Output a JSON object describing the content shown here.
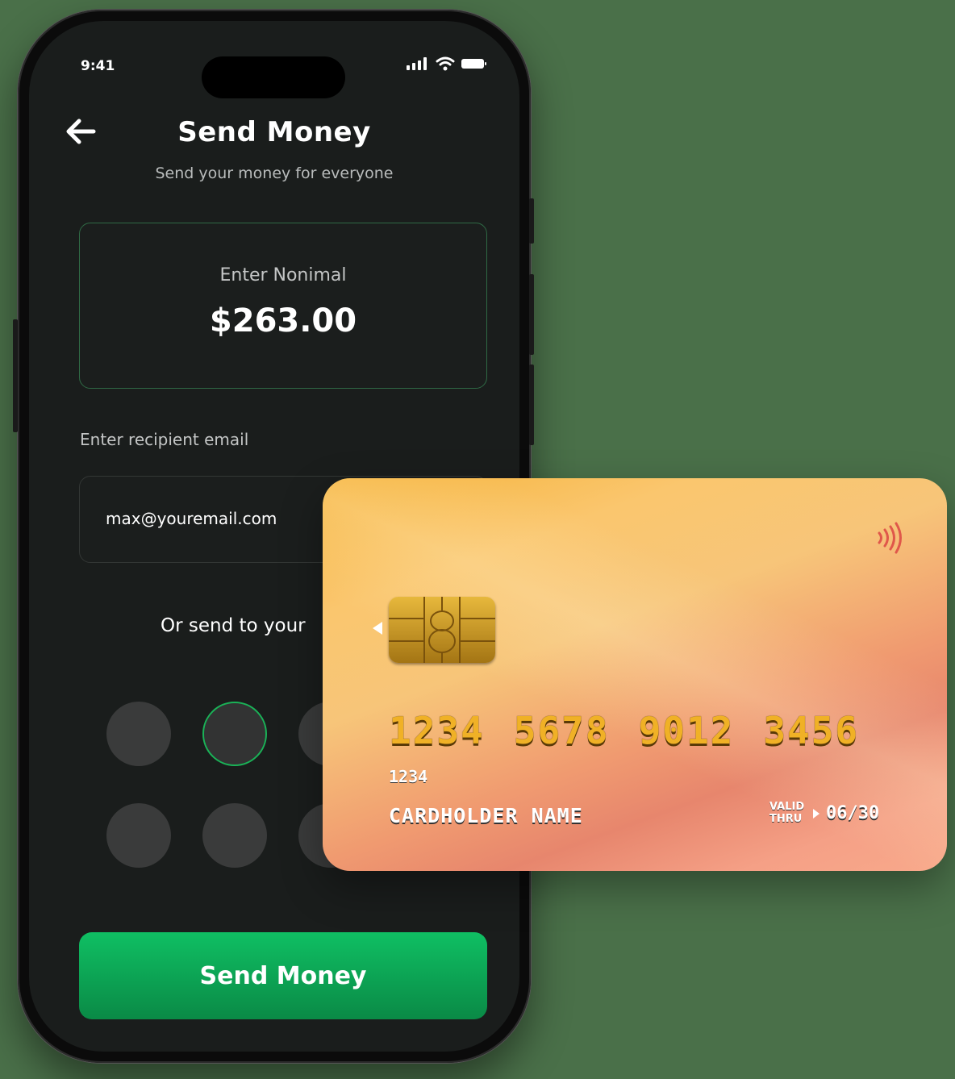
{
  "status_bar": {
    "time": "9:41"
  },
  "header": {
    "title": "Send Money",
    "subtitle": "Send your money for everyone"
  },
  "amount": {
    "label": "Enter Nonimal",
    "value": "$263.00"
  },
  "recipient": {
    "label": "Enter recipient email",
    "email": "max@youremail.com"
  },
  "contacts": {
    "label": "Or send to your",
    "selected_index": 1
  },
  "send_button": {
    "label": "Send Money"
  },
  "card": {
    "number_groups": [
      "1234",
      "5678",
      "9012",
      "3456"
    ],
    "small_number": "1234",
    "holder": "CARDHOLDER NAME",
    "valid_label_line1": "VALID",
    "valid_label_line2": "THRU",
    "valid_date": "06/30"
  },
  "colors": {
    "background": "#4a7049",
    "accent_green": "#0fbf63",
    "screen": "#1a1d1c"
  }
}
